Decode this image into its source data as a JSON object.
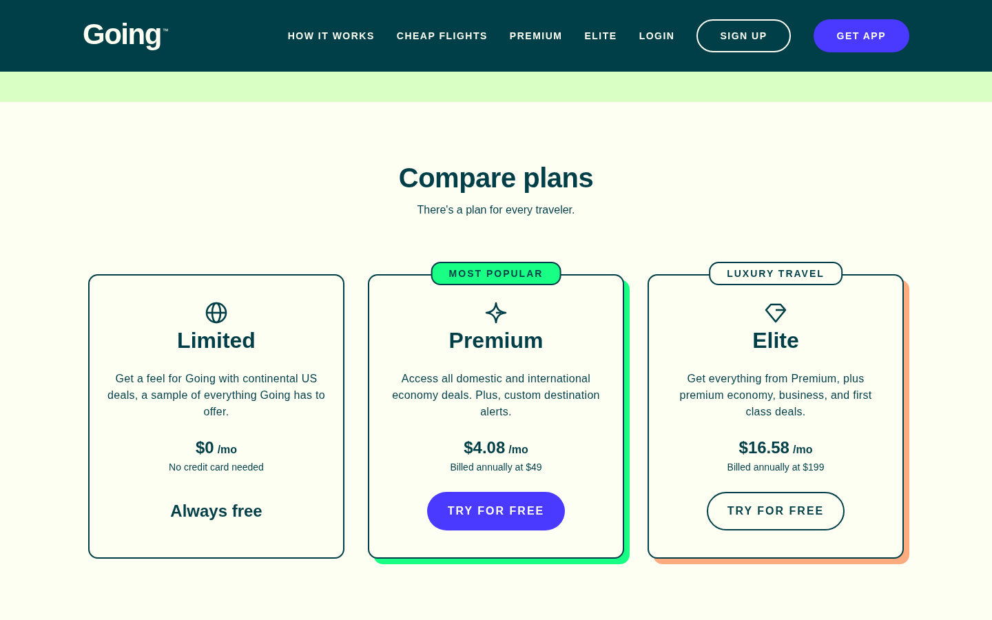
{
  "header": {
    "logo": {
      "text": "Going",
      "mark": "™"
    },
    "nav_links": [
      "HOW IT WORKS",
      "CHEAP FLIGHTS",
      "PREMIUM",
      "ELITE",
      "LOGIN"
    ],
    "buttons": [
      {
        "label": "SIGN UP",
        "kind": "outline"
      },
      {
        "label": "GET APP",
        "kind": "primary"
      }
    ]
  },
  "section": {
    "title": "Compare plans",
    "subtitle": "There's a plan for every traveler."
  },
  "plans": [
    {
      "name": "Limited",
      "description": "Get a feel for Going with continental US deals, a sample of everything Going has to offer.",
      "price": "$0",
      "period": "/mo",
      "note": "No credit card needed",
      "cta": {
        "kind": "text",
        "label": "Always free"
      }
    },
    {
      "badge": {
        "text": "MOST POPULAR",
        "highlighted": true
      },
      "color": "#19ff86",
      "name": "Premium",
      "description": "Access all domestic and international economy deals. Plus, custom destination alerts.",
      "price": "$4.08",
      "period": "/mo",
      "note": "Billed annually at $49",
      "cta": {
        "kind": "primary",
        "label": "TRY FOR FREE"
      }
    },
    {
      "badge": {
        "text": "LUXURY TRAVEL",
        "highlighted": false
      },
      "color": "#ffab80",
      "name": "Elite",
      "description": "Get everything from Premium, plus premium economy, business, and first class deals.",
      "price": "$16.58",
      "period": "/mo",
      "note": "Billed annually at $199",
      "cta": {
        "kind": "outline",
        "label": "TRY FOR FREE"
      }
    }
  ]
}
